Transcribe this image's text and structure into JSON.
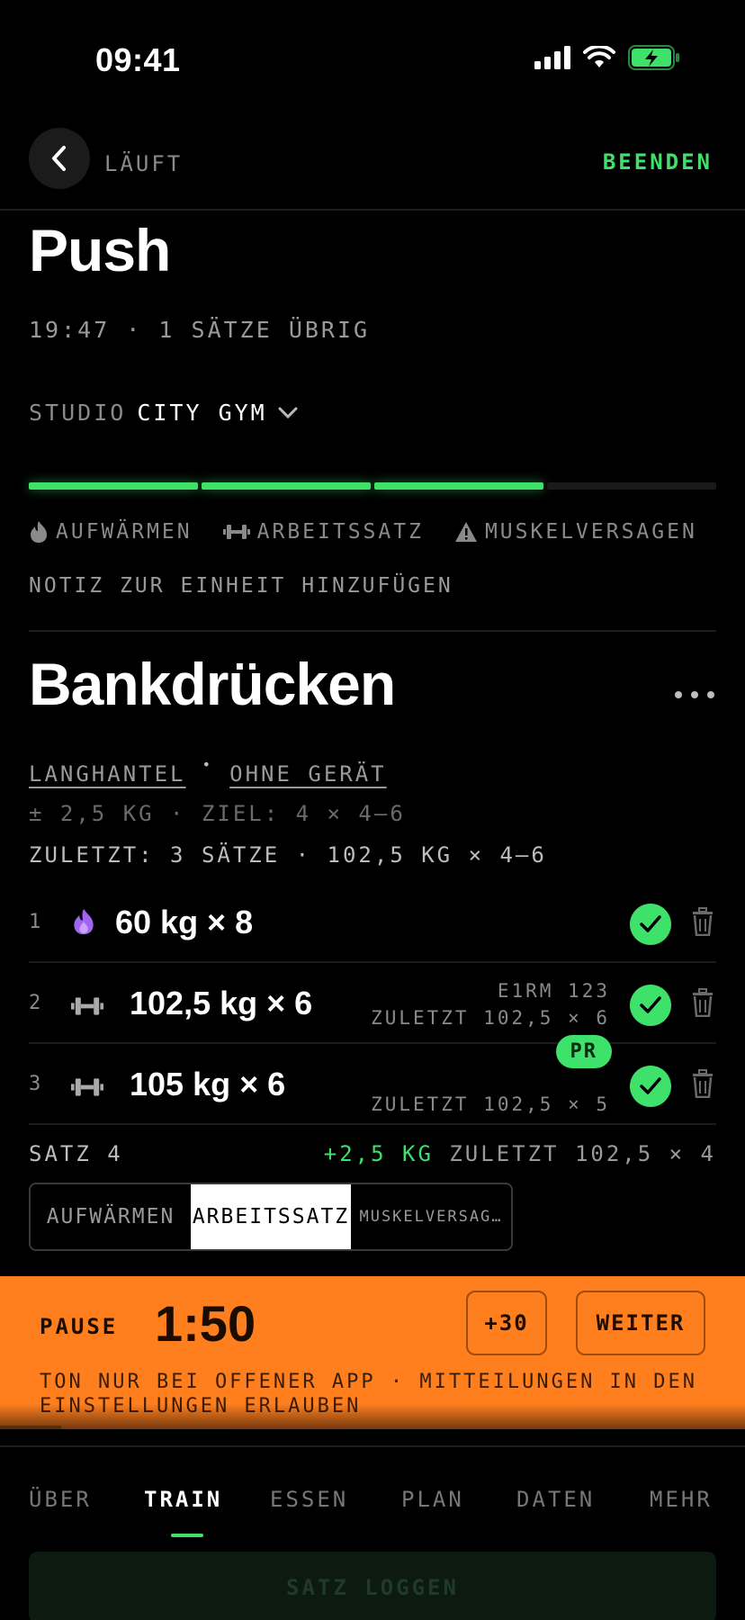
{
  "status_bar": {
    "time": "09:41"
  },
  "header": {
    "state": "LÄUFT",
    "end_label": "BEENDEN"
  },
  "workout": {
    "title": "Push",
    "meta": "19:47 · 1 SÄTZE ÜBRIG",
    "studio_label": "STUDIO",
    "studio_value": "CITY GYM",
    "progress": {
      "done_segments": 3,
      "total_segments": 4
    },
    "legend": [
      "AUFWÄRMEN",
      "ARBEITSSATZ",
      "MUSKELVERSAGEN"
    ],
    "note_link": "NOTIZ ZUR EINHEIT HINZUFÜGEN"
  },
  "exercise": {
    "title": "Bankdrücken",
    "equipment": [
      "LANGHANTEL",
      "OHNE GERÄT"
    ],
    "target": "± 2,5 KG · ZIEL: 4 × 4–6",
    "last": "ZULETZT: 3 SÄTZE · 102,5 KG × 4–6",
    "sets": [
      {
        "num": "1",
        "type": "warmup",
        "value": "60 kg × 8",
        "side1": "",
        "side2": "",
        "badge": ""
      },
      {
        "num": "2",
        "type": "working",
        "value": "102,5 kg × 6",
        "side1": "E1RM 123",
        "side2": "ZULETZT 102,5 × 6",
        "badge": ""
      },
      {
        "num": "3",
        "type": "working",
        "value": "105 kg × 6",
        "side1": "",
        "side2": "ZULETZT 102,5 × 5",
        "badge": "PR"
      }
    ],
    "next_set": {
      "label": "SATZ 4",
      "increment": "+2,5 KG",
      "hint": "ZULETZT 102,5 × 4"
    },
    "type_options": [
      "AUFWÄRMEN",
      "ARBEITSSATZ",
      "MUSKELVERSAG…"
    ]
  },
  "rest": {
    "label": "PAUSE",
    "time": "1:50",
    "add_label": "+30",
    "continue_label": "WEITER",
    "note": "TON NUR BEI OFFENER APP · MITTEILUNGEN IN DEN EINSTELLUNGEN ERLAUBEN"
  },
  "tabs": [
    "ÜBER",
    "TRAIN",
    "ESSEN",
    "PLAN",
    "DATEN",
    "MEHR"
  ],
  "active_tab": "TRAIN",
  "log_button": "SATZ LOGGEN",
  "colors": {
    "accent": "#3ee16a",
    "rest": "#ff7e1e",
    "warmup": "#a064f0",
    "background": "#000000"
  }
}
